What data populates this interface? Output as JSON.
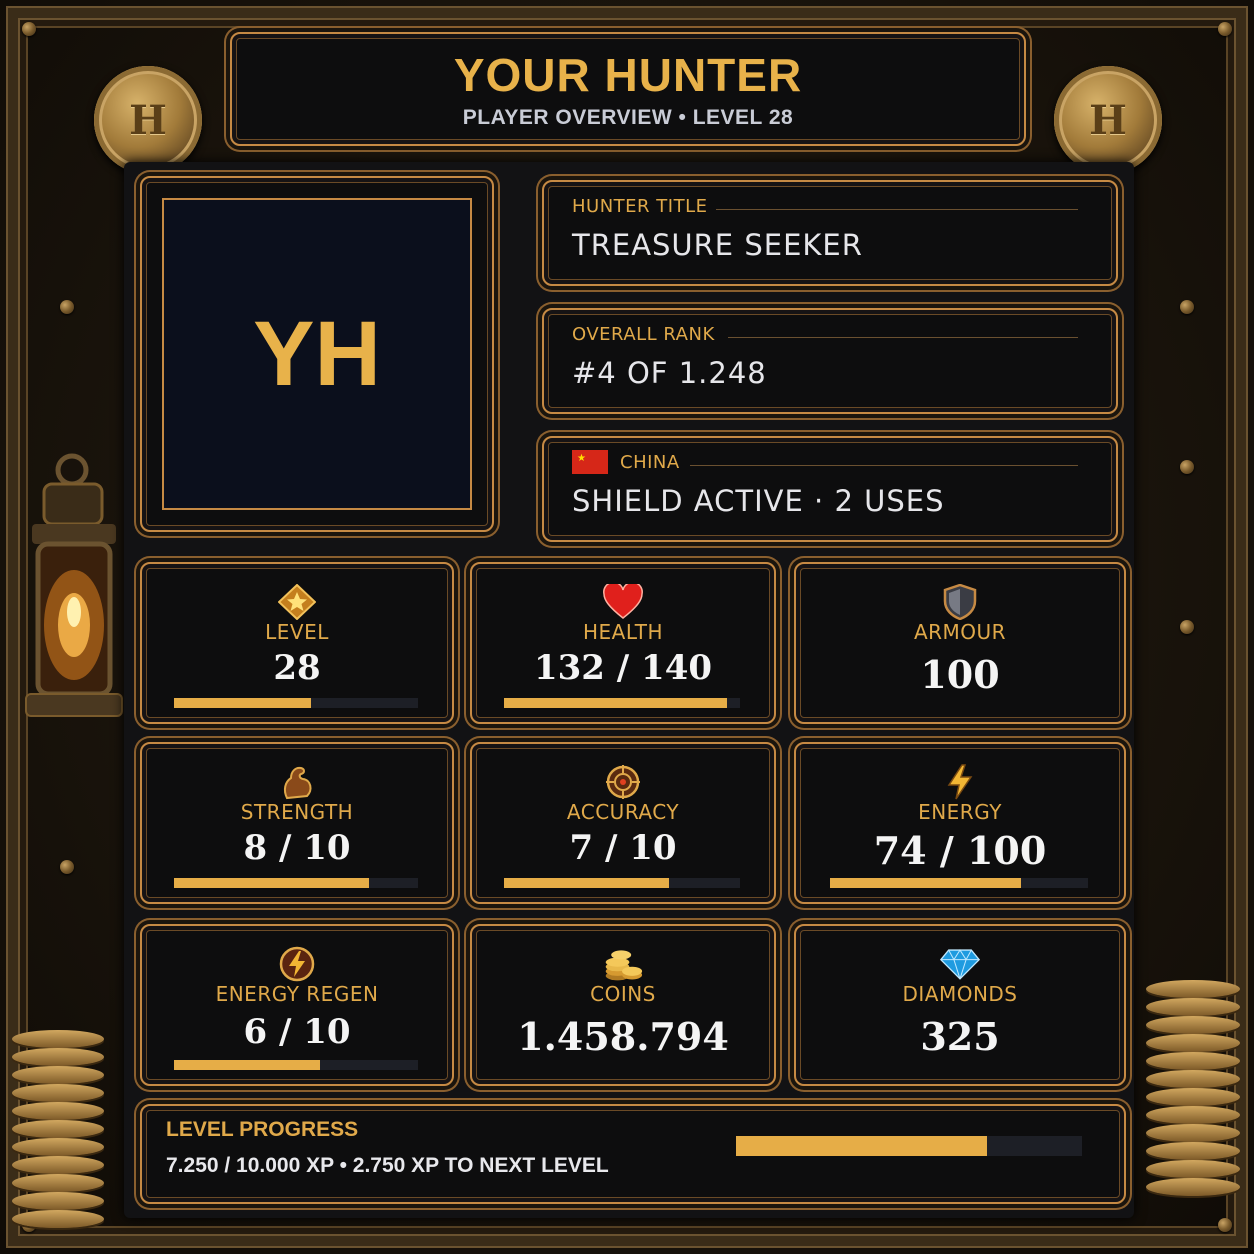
{
  "header": {
    "title": "YOUR HUNTER",
    "subtitle": "PLAYER OVERVIEW  •  LEVEL 28"
  },
  "avatar": {
    "initials": "YH"
  },
  "info_cards": [
    {
      "label": "HUNTER TITLE",
      "value": "TREASURE SEEKER"
    },
    {
      "label": "OVERALL RANK",
      "value": "#4  OF  1.248"
    },
    {
      "label": "CHINA",
      "value": "SHIELD ACTIVE  ·  2 USES",
      "flag": "china-flag"
    }
  ],
  "stats": [
    {
      "id": "level",
      "icon": "star-icon",
      "label": "LEVEL",
      "value": "28",
      "progress": 0.56
    },
    {
      "id": "health",
      "icon": "heart-icon",
      "label": "HEALTH",
      "value": "132 / 140",
      "progress": 0.943
    },
    {
      "id": "armour",
      "icon": "shield-icon",
      "label": "ARMOUR",
      "value": "100"
    },
    {
      "id": "strength",
      "icon": "flexed-arm-icon",
      "label": "STRENGTH",
      "value": "8 / 10",
      "progress": 0.8
    },
    {
      "id": "accuracy",
      "icon": "crosshair-icon",
      "label": "ACCURACY",
      "value": "7 / 10",
      "progress": 0.7
    },
    {
      "id": "energy",
      "icon": "lightning-icon",
      "label": "ENERGY",
      "value": "74 / 100",
      "progress": 0.74
    },
    {
      "id": "energy_regen",
      "icon": "lightning-circle-icon",
      "label": "ENERGY REGEN",
      "value": "6 / 10",
      "progress": 0.6
    },
    {
      "id": "coins",
      "icon": "coins-icon",
      "label": "COINS",
      "value": "1.458.794"
    },
    {
      "id": "diamonds",
      "icon": "diamond-icon",
      "label": "DIAMONDS",
      "value": "325"
    }
  ],
  "level_progress": {
    "label": "LEVEL PROGRESS",
    "detail": "7.250 / 10.000 XP   •   2.750 XP TO NEXT LEVEL",
    "progress": 0.725
  },
  "colors": {
    "accent": "#e8b24a",
    "panel": "#0d0d0e",
    "border": "#c68a44",
    "bar_fill": "#e6ad47"
  }
}
